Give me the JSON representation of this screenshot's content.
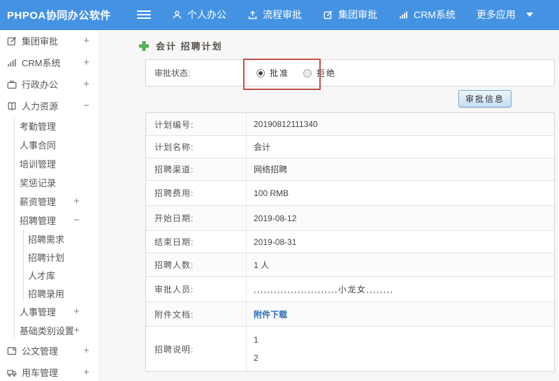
{
  "navbar": {
    "brand": "PHPOA协同办公软件",
    "menu": [
      {
        "label": "个人办公"
      },
      {
        "label": "流程审批"
      },
      {
        "label": "集团审批"
      },
      {
        "label": "CRM系统"
      },
      {
        "label": "更多应用"
      }
    ]
  },
  "sidebar": {
    "items": [
      {
        "label": "集团审批",
        "toggle": "+"
      },
      {
        "label": "CRM系统",
        "toggle": "+"
      },
      {
        "label": "行政办公",
        "toggle": "+"
      },
      {
        "label": "人力资源",
        "toggle": "−"
      },
      {
        "label": "考勤管理"
      },
      {
        "label": "人事合同"
      },
      {
        "label": "培训管理"
      },
      {
        "label": "奖惩记录"
      },
      {
        "label": "薪资管理",
        "toggle": "+"
      },
      {
        "label": "招聘管理",
        "toggle": "−"
      },
      {
        "label": "招聘需求"
      },
      {
        "label": "招聘计划"
      },
      {
        "label": "人才库"
      },
      {
        "label": "招聘录用"
      },
      {
        "label": "人事管理",
        "toggle": "+"
      },
      {
        "label": "基础类别设置",
        "toggle": "+"
      },
      {
        "label": "公文管理",
        "toggle": "+"
      },
      {
        "label": "用车管理",
        "toggle": "+"
      }
    ]
  },
  "main": {
    "title": "会计 招聘计划",
    "approval_row": {
      "label": "审批状态:",
      "radio_approve": "批准",
      "radio_reject": "拒绝"
    },
    "approve_button": "审批信息",
    "fields": {
      "plan_no": {
        "label": "计划编号:",
        "value": "20190812111340"
      },
      "plan_name": {
        "label": "计划名称:",
        "value": "会计"
      },
      "channel": {
        "label": "招聘渠道:",
        "value": "网络招聘"
      },
      "fee": {
        "label": "招聘费用:",
        "value": "100 RMB"
      },
      "start_date": {
        "label": "开始日期:",
        "value": "2019-08-12"
      },
      "end_date": {
        "label": "结束日期:",
        "value": "2019-08-31"
      },
      "headcount": {
        "label": "招聘人数:",
        "value": "1 人"
      },
      "approvers": {
        "label": "审批人员:",
        "value": ",,,,,,,,,,,,,,,,,,,,,,,,,小龙女,,,,,,,,"
      },
      "attachment": {
        "label": "附件文档:",
        "value": "附件下载"
      },
      "description": {
        "label": "招聘说明:",
        "line1": "1",
        "line2": "2"
      }
    }
  },
  "colors": {
    "navbar_blue": "#4493e3",
    "highlight_red": "#c0504d",
    "link_blue": "#2a6db8",
    "accent_green": "#54b554"
  }
}
